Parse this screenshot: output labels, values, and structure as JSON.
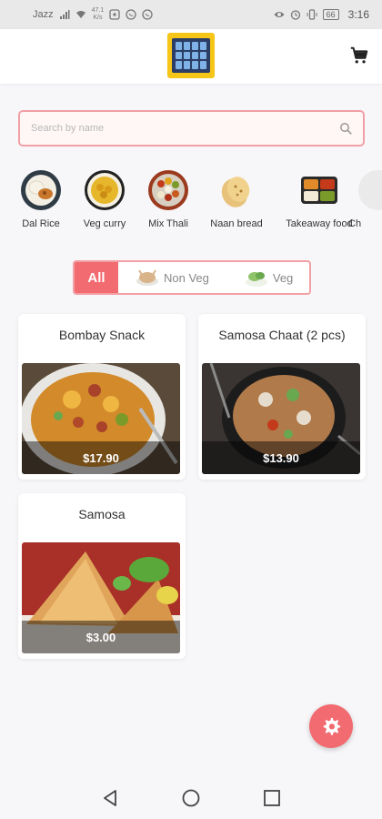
{
  "status_bar": {
    "carrier": "Jazz",
    "net_speed_value": "47.1",
    "net_speed_unit": "K/s",
    "battery": "66",
    "time": "3:16"
  },
  "app_bar": {
    "logo_icon": "app-logo",
    "cart_icon": "shopping-cart-icon"
  },
  "search": {
    "placeholder": "Search by name",
    "value": "",
    "icon": "search-icon"
  },
  "categories": [
    {
      "label": "Dal Rice"
    },
    {
      "label": "Veg curry"
    },
    {
      "label": "Mix Thali"
    },
    {
      "label": "Naan bread"
    },
    {
      "label": "Takeaway food"
    },
    {
      "label": "Ch"
    }
  ],
  "filter": {
    "all_label": "All",
    "nonveg_label": "Non Veg",
    "veg_label": "Veg"
  },
  "products": [
    {
      "name": "Bombay Snack",
      "price": "$17.90"
    },
    {
      "name": "Samosa Chaat (2 pcs)",
      "price": "$13.90"
    },
    {
      "name": "Samosa",
      "price": "$3.00"
    }
  ],
  "fab": {
    "icon": "settings-gear-icon"
  },
  "nav_bar": {
    "back_icon": "back-triangle-icon",
    "home_icon": "home-circle-icon",
    "recents_icon": "recents-square-icon"
  },
  "colors": {
    "accent": "#f26b70",
    "accent_border": "#f2a0a5",
    "logo_bg": "#f5c518"
  }
}
